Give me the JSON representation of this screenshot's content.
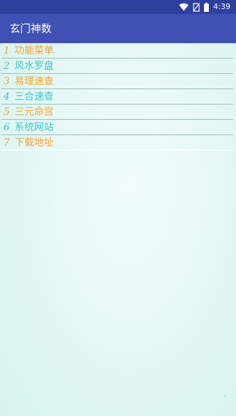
{
  "status_bar": {
    "time": "4:39",
    "icons": [
      "wifi-icon",
      "no-sim-icon",
      "battery-icon"
    ]
  },
  "app_bar": {
    "title": "玄门神数"
  },
  "menu": {
    "items": [
      {
        "num": "1",
        "label": "功能菜单",
        "color": "orange"
      },
      {
        "num": "2",
        "label": "风水罗盘",
        "color": "cyan"
      },
      {
        "num": "3",
        "label": "易理速查",
        "color": "orange"
      },
      {
        "num": "4",
        "label": "三合速查",
        "color": "cyan"
      },
      {
        "num": "5",
        "label": "三元命宫",
        "color": "orange"
      },
      {
        "num": "6",
        "label": "系统网站",
        "color": "cyan"
      },
      {
        "num": "7",
        "label": "下载地址",
        "color": "orange"
      }
    ]
  },
  "colors": {
    "status_bar": "#2e3f9c",
    "app_bar": "#3f51b5",
    "orange": "#f2a33a",
    "cyan": "#3fc6d0",
    "background": "#e6f8f5"
  }
}
